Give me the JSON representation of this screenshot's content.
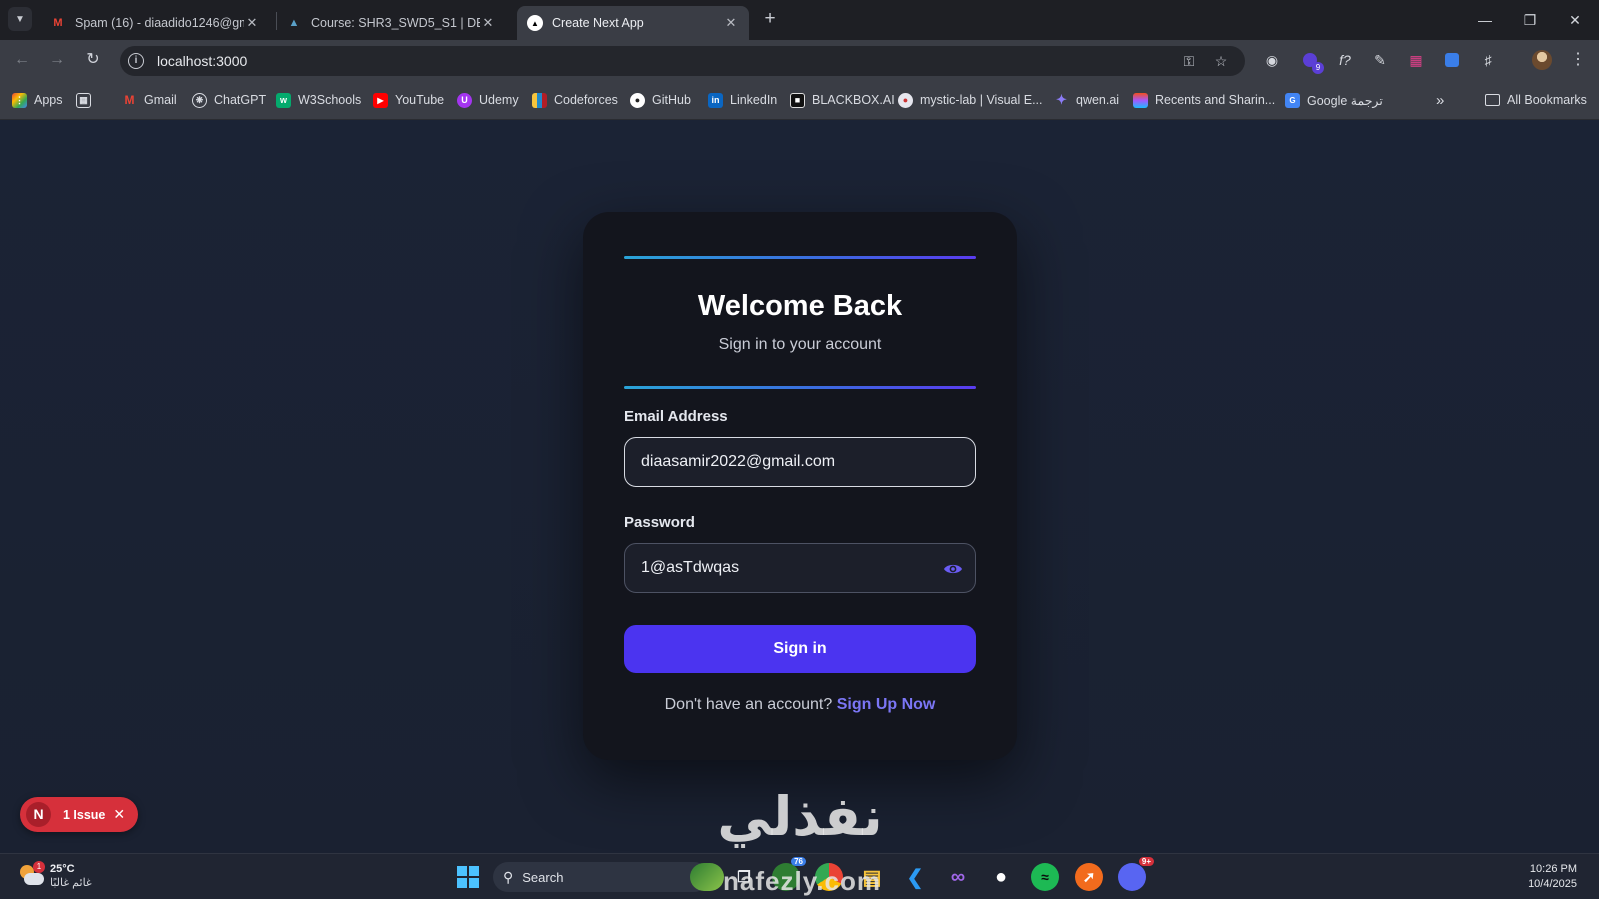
{
  "browser": {
    "tabs": [
      {
        "title": "Spam (16) - diaadido1246@gm",
        "favicon": "gmail-icon"
      },
      {
        "title": "Course: SHR3_SWD5_S1 | DEPI L",
        "favicon": "depi-icon"
      },
      {
        "title": "Create Next App",
        "favicon": "nextjs-icon"
      }
    ],
    "url": "localhost:3000",
    "bookmarks": [
      "Apps",
      "Gmail",
      "ChatGPT",
      "W3Schools",
      "YouTube",
      "Udemy",
      "Codeforces",
      "GitHub",
      "LinkedIn",
      "BLACKBOX.AI",
      "mystic-lab | Visual E...",
      "qwen.ai",
      "Recents and Sharin...",
      "Google ترجمة"
    ],
    "all_bookmarks": "All Bookmarks",
    "extension_badge": "9"
  },
  "login": {
    "title": "Welcome Back",
    "subtitle": "Sign in to your account",
    "email_label": "Email Address",
    "email_value": "diaasamir2022@gmail.com",
    "password_label": "Password",
    "password_value": "1@asTdwqas",
    "submit_label": "Sign in",
    "no_account_text": "Don't have an account?",
    "signup_link": "Sign Up Now",
    "colors": {
      "accent": "#4b34f0",
      "link": "#7b76f5",
      "card": "#13151d"
    }
  },
  "dev_overlay": {
    "initial": "N",
    "issues_label": "1 Issue"
  },
  "watermark": {
    "arabic": "نفذلي",
    "latin": "nafezly.com"
  },
  "taskbar": {
    "weather_temp": "25°C",
    "weather_desc": "غائم غالبًا",
    "weather_badge": "1",
    "search_label": "Search",
    "chrome_badge": "76",
    "discord_badge": "9+",
    "time": "10:26 PM",
    "date": "10/4/2025"
  }
}
